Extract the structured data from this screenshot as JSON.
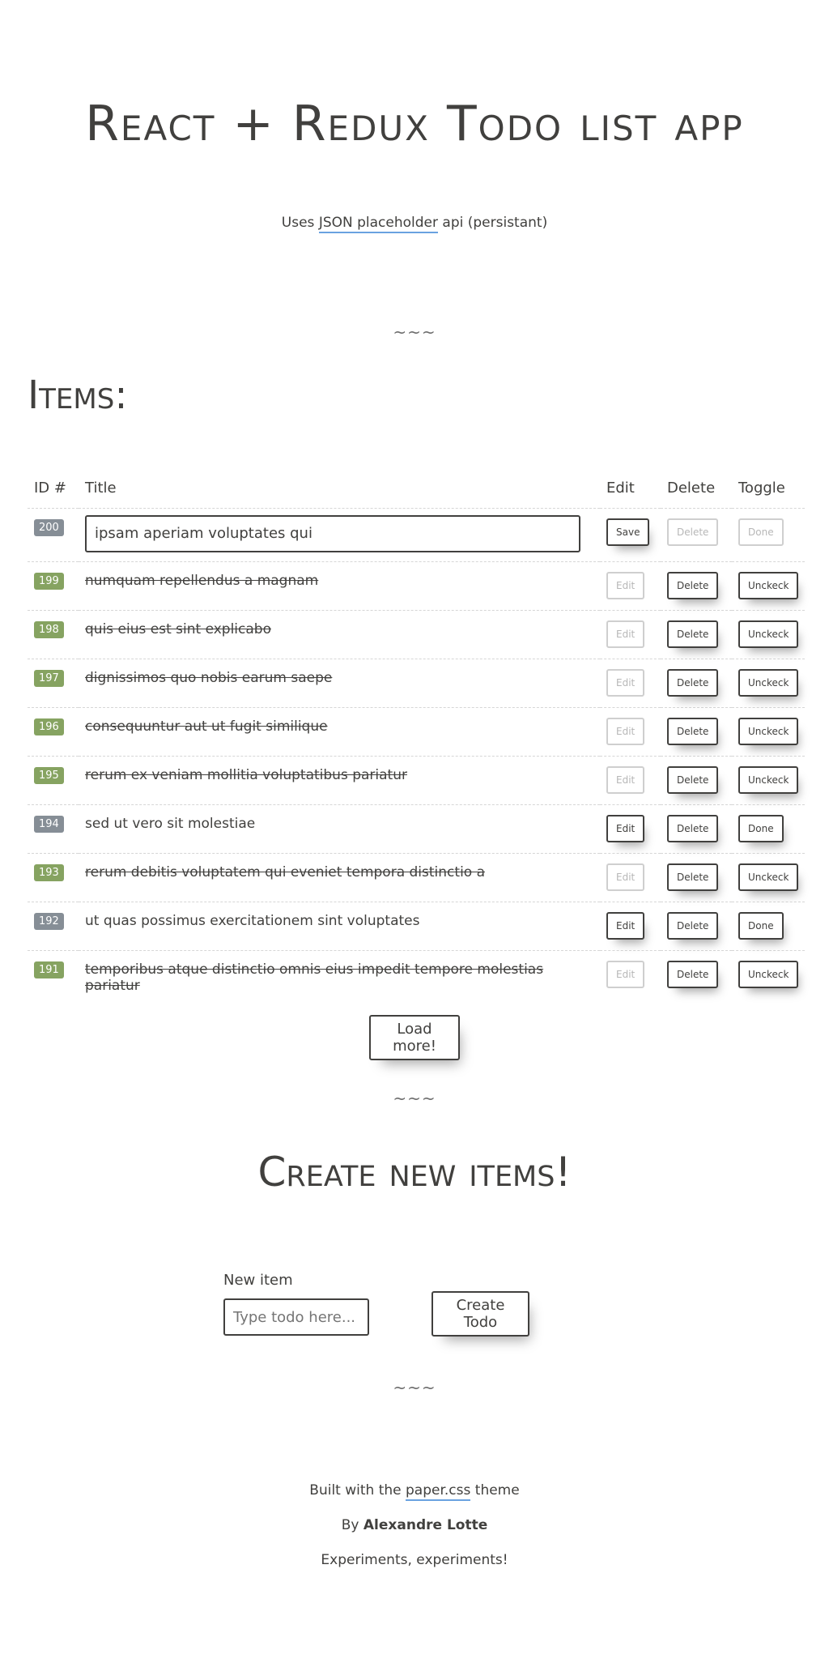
{
  "header": {
    "title": "React + Redux Todo list app",
    "subtitle_prefix": "Uses ",
    "subtitle_link": "JSON placeholder",
    "subtitle_suffix": " api (persistant)"
  },
  "divider": "~~~",
  "items_section": {
    "heading": "Items:",
    "columns": {
      "id": "ID #",
      "title": "Title",
      "edit": "Edit",
      "delete": "Delete",
      "toggle": "Toggle"
    },
    "editing_row": {
      "id": "200",
      "input_value": "ipsam aperiam voluptates qui",
      "save": "Save",
      "delete": "Delete",
      "toggle": "Done"
    },
    "rows": [
      {
        "id": "199",
        "title": "numquam repellendus a magnam",
        "completed": true,
        "edit": "Edit",
        "delete": "Delete",
        "toggle": "Unckeck"
      },
      {
        "id": "198",
        "title": "quis eius est sint explicabo",
        "completed": true,
        "edit": "Edit",
        "delete": "Delete",
        "toggle": "Unckeck"
      },
      {
        "id": "197",
        "title": "dignissimos quo nobis earum saepe",
        "completed": true,
        "edit": "Edit",
        "delete": "Delete",
        "toggle": "Unckeck"
      },
      {
        "id": "196",
        "title": "consequuntur aut ut fugit similique",
        "completed": true,
        "edit": "Edit",
        "delete": "Delete",
        "toggle": "Unckeck"
      },
      {
        "id": "195",
        "title": "rerum ex veniam mollitia voluptatibus pariatur",
        "completed": true,
        "edit": "Edit",
        "delete": "Delete",
        "toggle": "Unckeck"
      },
      {
        "id": "194",
        "title": "sed ut vero sit molestiae",
        "completed": false,
        "edit": "Edit",
        "delete": "Delete",
        "toggle": "Done"
      },
      {
        "id": "193",
        "title": "rerum debitis voluptatem qui eveniet tempora distinctio a",
        "completed": true,
        "edit": "Edit",
        "delete": "Delete",
        "toggle": "Unckeck"
      },
      {
        "id": "192",
        "title": "ut quas possimus exercitationem sint voluptates",
        "completed": false,
        "edit": "Edit",
        "delete": "Delete",
        "toggle": "Done"
      },
      {
        "id": "191",
        "title": "temporibus atque distinctio omnis eius impedit tempore molestias pariatur",
        "completed": true,
        "edit": "Edit",
        "delete": "Delete",
        "toggle": "Unckeck"
      }
    ],
    "load_more": "Load more!"
  },
  "create_section": {
    "heading": "Create new items!",
    "label": "New item",
    "placeholder": "Type todo here...",
    "button": "Create Todo"
  },
  "footer": {
    "built_prefix": "Built with the ",
    "built_link": "paper.css",
    "built_suffix": " theme",
    "by_prefix": "By ",
    "author": "Alexandre Lotte",
    "tagline": "Experiments, experiments!"
  },
  "colors": {
    "text": "#41403e",
    "badge_completed": "#86a361",
    "badge_open": "#868e96",
    "link_underline": "#6aa2e0"
  }
}
